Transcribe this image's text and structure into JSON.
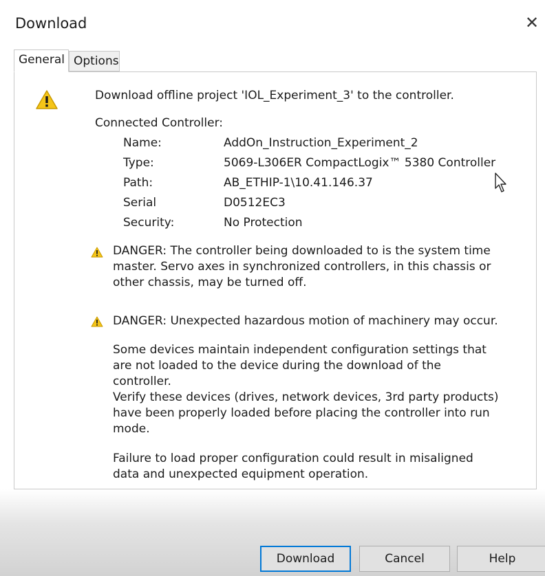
{
  "window": {
    "title": "Download",
    "close_glyph": "✕"
  },
  "tabs": [
    {
      "label": "General"
    },
    {
      "label": "Options"
    }
  ],
  "general": {
    "message": "Download offline project 'IOL_Experiment_3' to the controller.",
    "connected_controller_heading": "Connected Controller:",
    "fields": [
      {
        "label": "Name:",
        "value": "AddOn_Instruction_Experiment_2"
      },
      {
        "label": "Type:",
        "value": "5069-L306ER CompactLogix™ 5380 Controller"
      },
      {
        "label": "Path:",
        "value": "AB_ETHIP-1\\10.41.146.37"
      },
      {
        "label": "Serial",
        "value": "D0512EC3"
      },
      {
        "label": "Security:",
        "value": "No Protection"
      }
    ],
    "danger1": "DANGER: The controller being downloaded to is the system time master.  Servo axes in synchronized controllers, in this chassis or other chassis, may be turned off.",
    "danger2": "DANGER: Unexpected hazardous motion of machinery may occur.",
    "para1": "Some devices maintain independent configuration settings that are not loaded to the device during the download of the controller.",
    "para2": "Verify these devices (drives, network devices, 3rd party products) have been properly loaded before placing the controller into run mode.",
    "para3": "Failure to load proper configuration could result in misaligned data and unexpected equipment operation."
  },
  "buttons": {
    "download": "Download",
    "cancel": "Cancel",
    "help": "Help"
  },
  "icons": {
    "warning_color": "#f5c518",
    "warning_icon": "warning-triangle-icon"
  }
}
